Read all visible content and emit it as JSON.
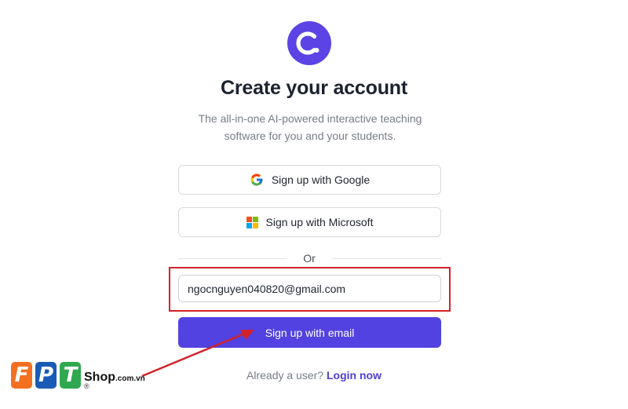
{
  "brand": {
    "logo_color": "#5b43e6"
  },
  "header": {
    "title": "Create your account",
    "subtitle": "The all-in-one AI-powered interactive teaching software for you and your students."
  },
  "auth": {
    "google_label": "Sign up with Google",
    "microsoft_label": "Sign up with Microsoft",
    "divider_label": "Or",
    "email_value": "ngocnguyen040820@gmail.com",
    "submit_label": "Sign up with email",
    "submit_color": "#5242e1"
  },
  "footer": {
    "prompt": "Already a user?",
    "login_label": "Login now"
  },
  "annotation": {
    "highlight_color": "#d1232a",
    "arrow_color": "#d1232a"
  },
  "watermark": {
    "letters": [
      "F",
      "P",
      "T"
    ],
    "registered": "®",
    "shop": "Shop",
    "domain": ".com.vn",
    "colors": [
      "#f37021",
      "#1a5bb5",
      "#2fa84f"
    ]
  }
}
